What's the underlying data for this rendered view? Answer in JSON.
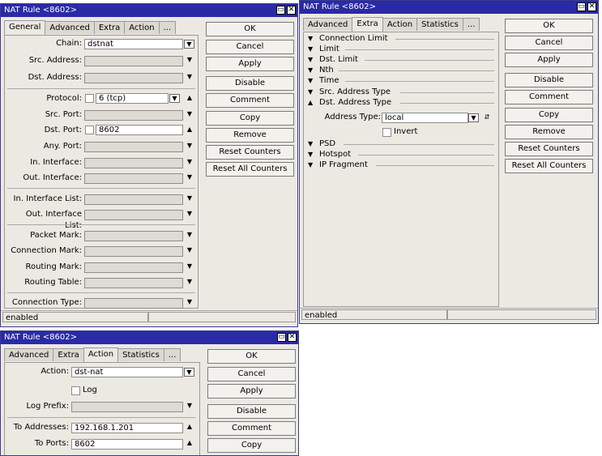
{
  "icons": {
    "minimize": "▭",
    "close": "✕",
    "dropdown": "▼",
    "spin": "⇵",
    "arrow_down": "▼",
    "arrow_up": "▲"
  },
  "win_general": {
    "title": "NAT Rule <8602>",
    "tabs": [
      "General",
      "Advanced",
      "Extra",
      "Action",
      "..."
    ],
    "active_tab": "General",
    "fields": {
      "chain": {
        "label": "Chain:",
        "value": "dstnat"
      },
      "src_address": {
        "label": "Src. Address:",
        "value": ""
      },
      "dst_address": {
        "label": "Dst. Address:",
        "value": ""
      },
      "protocol": {
        "label": "Protocol:",
        "value": "6 (tcp)"
      },
      "src_port": {
        "label": "Src. Port:",
        "value": ""
      },
      "dst_port": {
        "label": "Dst. Port:",
        "value": "8602"
      },
      "any_port": {
        "label": "Any. Port:",
        "value": ""
      },
      "in_interface": {
        "label": "In. Interface:",
        "value": ""
      },
      "out_interface": {
        "label": "Out. Interface:",
        "value": ""
      },
      "in_interface_list": {
        "label": "In. Interface List:",
        "value": ""
      },
      "out_interface_list": {
        "label": "Out. Interface List:",
        "value": ""
      },
      "packet_mark": {
        "label": "Packet Mark:",
        "value": ""
      },
      "connection_mark": {
        "label": "Connection Mark:",
        "value": ""
      },
      "routing_mark": {
        "label": "Routing Mark:",
        "value": ""
      },
      "routing_table": {
        "label": "Routing Table:",
        "value": ""
      },
      "connection_type": {
        "label": "Connection Type:",
        "value": ""
      }
    },
    "buttons": [
      "OK",
      "Cancel",
      "Apply",
      "Disable",
      "Comment",
      "Copy",
      "Remove",
      "Reset Counters",
      "Reset All Counters"
    ],
    "status": "enabled"
  },
  "win_extra": {
    "title": "NAT Rule <8602>",
    "tabs": [
      "Advanced",
      "Extra",
      "Action",
      "Statistics",
      "..."
    ],
    "active_tab": "Extra",
    "sections": [
      "Connection Limit",
      "Limit",
      "Dst. Limit",
      "Nth",
      "Time",
      "Src. Address Type",
      "Dst. Address Type"
    ],
    "address_type": {
      "label": "Address Type:",
      "value": "local"
    },
    "invert_label": "Invert",
    "sections_after": [
      "PSD",
      "Hotspot",
      "IP Fragment"
    ],
    "buttons": [
      "OK",
      "Cancel",
      "Apply",
      "Disable",
      "Comment",
      "Copy",
      "Remove",
      "Reset Counters",
      "Reset All Counters"
    ],
    "status": "enabled"
  },
  "win_action": {
    "title": "NAT Rule <8602>",
    "tabs": [
      "Advanced",
      "Extra",
      "Action",
      "Statistics",
      "..."
    ],
    "active_tab": "Action",
    "action": {
      "label": "Action:",
      "value": "dst-nat"
    },
    "log_label": "Log",
    "log_prefix": {
      "label": "Log Prefix:",
      "value": ""
    },
    "to_addresses": {
      "label": "To Addresses:",
      "value": "192.168.1.201"
    },
    "to_ports": {
      "label": "To Ports:",
      "value": "8602"
    },
    "buttons": [
      "OK",
      "Cancel",
      "Apply",
      "Disable",
      "Comment",
      "Copy"
    ]
  }
}
